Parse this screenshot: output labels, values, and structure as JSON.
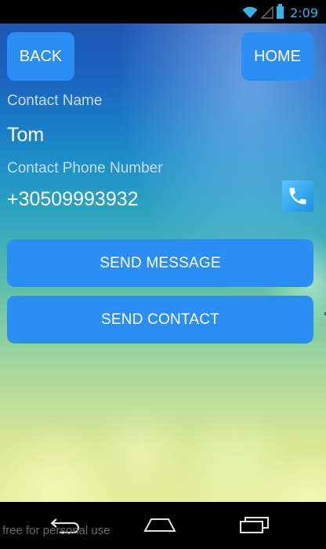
{
  "status_bar": {
    "time": "2:09",
    "icons": [
      "wifi-icon",
      "signal-icon",
      "battery-icon"
    ],
    "accent_color": "#33b5e5"
  },
  "header": {
    "back_label": "BACK",
    "home_label": "HOME"
  },
  "contact": {
    "name_label": "Contact Name",
    "name_value": "Tom",
    "phone_label": "Contact Phone Number",
    "phone_value": "+30509993932",
    "call_icon": "phone-icon"
  },
  "actions": {
    "send_message_label": "SEND MESSAGE",
    "send_contact_label": "SEND CONTACT"
  },
  "colors": {
    "button": "#2b8ef5",
    "label_text": "#c8dcf0",
    "value_text": "#ffffff"
  },
  "nav_bar": {
    "icons": [
      "back-nav-icon",
      "home-nav-icon",
      "recent-apps-icon"
    ],
    "watermark": "free for personal use"
  }
}
